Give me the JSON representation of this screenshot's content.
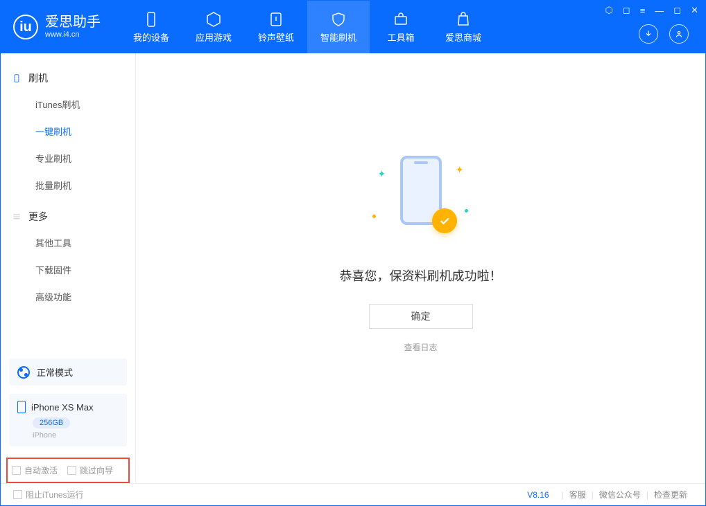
{
  "app": {
    "name": "爱思助手",
    "url": "www.i4.cn"
  },
  "tabs": [
    {
      "label": "我的设备"
    },
    {
      "label": "应用游戏"
    },
    {
      "label": "铃声壁纸"
    },
    {
      "label": "智能刷机"
    },
    {
      "label": "工具箱"
    },
    {
      "label": "爱思商城"
    }
  ],
  "sidebar": {
    "sec1": {
      "title": "刷机",
      "items": [
        "iTunes刷机",
        "一键刷机",
        "专业刷机",
        "批量刷机"
      ]
    },
    "sec2": {
      "title": "更多",
      "items": [
        "其他工具",
        "下载固件",
        "高级功能"
      ]
    }
  },
  "mode": {
    "label": "正常模式"
  },
  "device": {
    "name": "iPhone XS Max",
    "capacity": "256GB",
    "type": "iPhone"
  },
  "options": {
    "auto_activate": "自动激活",
    "skip_guide": "跳过向导"
  },
  "main": {
    "message": "恭喜您，保资料刷机成功啦！",
    "ok": "确定",
    "view_log": "查看日志"
  },
  "footer": {
    "block_itunes": "阻止iTunes运行",
    "version": "V8.16",
    "links": [
      "客服",
      "微信公众号",
      "检查更新"
    ]
  }
}
